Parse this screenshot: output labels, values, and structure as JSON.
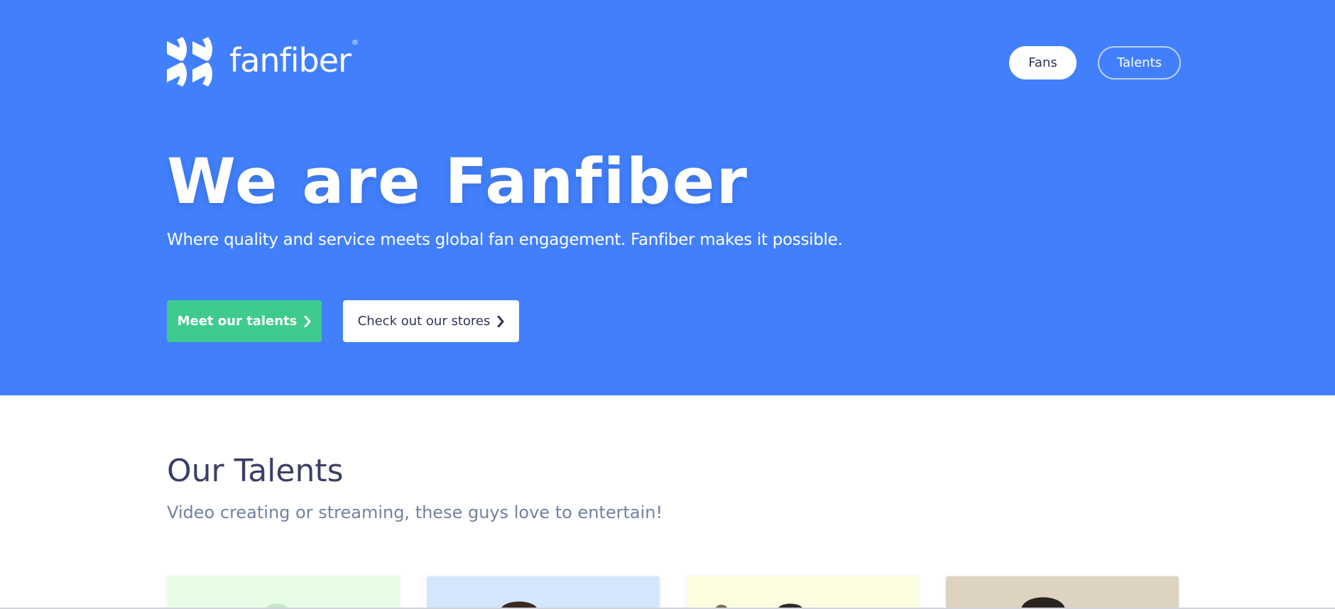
{
  "brand": {
    "name": "fanfiber",
    "registered_mark": "®"
  },
  "nav": {
    "fans_label": "Fans",
    "talents_label": "Talents"
  },
  "hero": {
    "title": "We are Fanfiber",
    "subtitle": "Where quality and service meets global fan engagement. Fanfiber makes it possible.",
    "primary_cta": "Meet our talents",
    "secondary_cta": "Check out our stores"
  },
  "talents": {
    "title": "Our Talents",
    "subtitle": "Video creating or streaming, these guys love to entertain!",
    "cards": [
      {
        "bg": "#e8fde6"
      },
      {
        "bg": "#d4e6fb"
      },
      {
        "bg": "#fdfee0"
      },
      {
        "bg": "#ded3c1"
      }
    ]
  },
  "colors": {
    "hero_blue": "#417ffc",
    "accent_green": "#3fcb8e",
    "heading_navy": "#3a3f66",
    "muted_text": "#7282a0"
  },
  "icons": [
    "fanfiber-logo-icon",
    "chevron-right-icon"
  ]
}
